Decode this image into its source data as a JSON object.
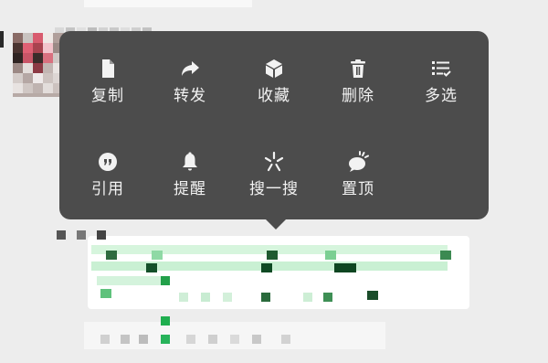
{
  "context_menu": {
    "items": [
      {
        "label": "复制",
        "icon": "document-icon"
      },
      {
        "label": "转发",
        "icon": "forward-arrow-icon"
      },
      {
        "label": "收藏",
        "icon": "cube-icon"
      },
      {
        "label": "删除",
        "icon": "trash-icon"
      },
      {
        "label": "多选",
        "icon": "multi-select-icon"
      },
      {
        "label": "引用",
        "icon": "quote-icon"
      },
      {
        "label": "提醒",
        "icon": "bell-icon"
      },
      {
        "label": "搜一搜",
        "icon": "sparkle-search-icon"
      },
      {
        "label": "置顶",
        "icon": "pin-top-icon"
      }
    ]
  },
  "colors": {
    "background": "#ededed",
    "menu_background": "#4c4c4c",
    "menu_text": "#f2f2f2",
    "bubble_green": "#95ec69"
  }
}
